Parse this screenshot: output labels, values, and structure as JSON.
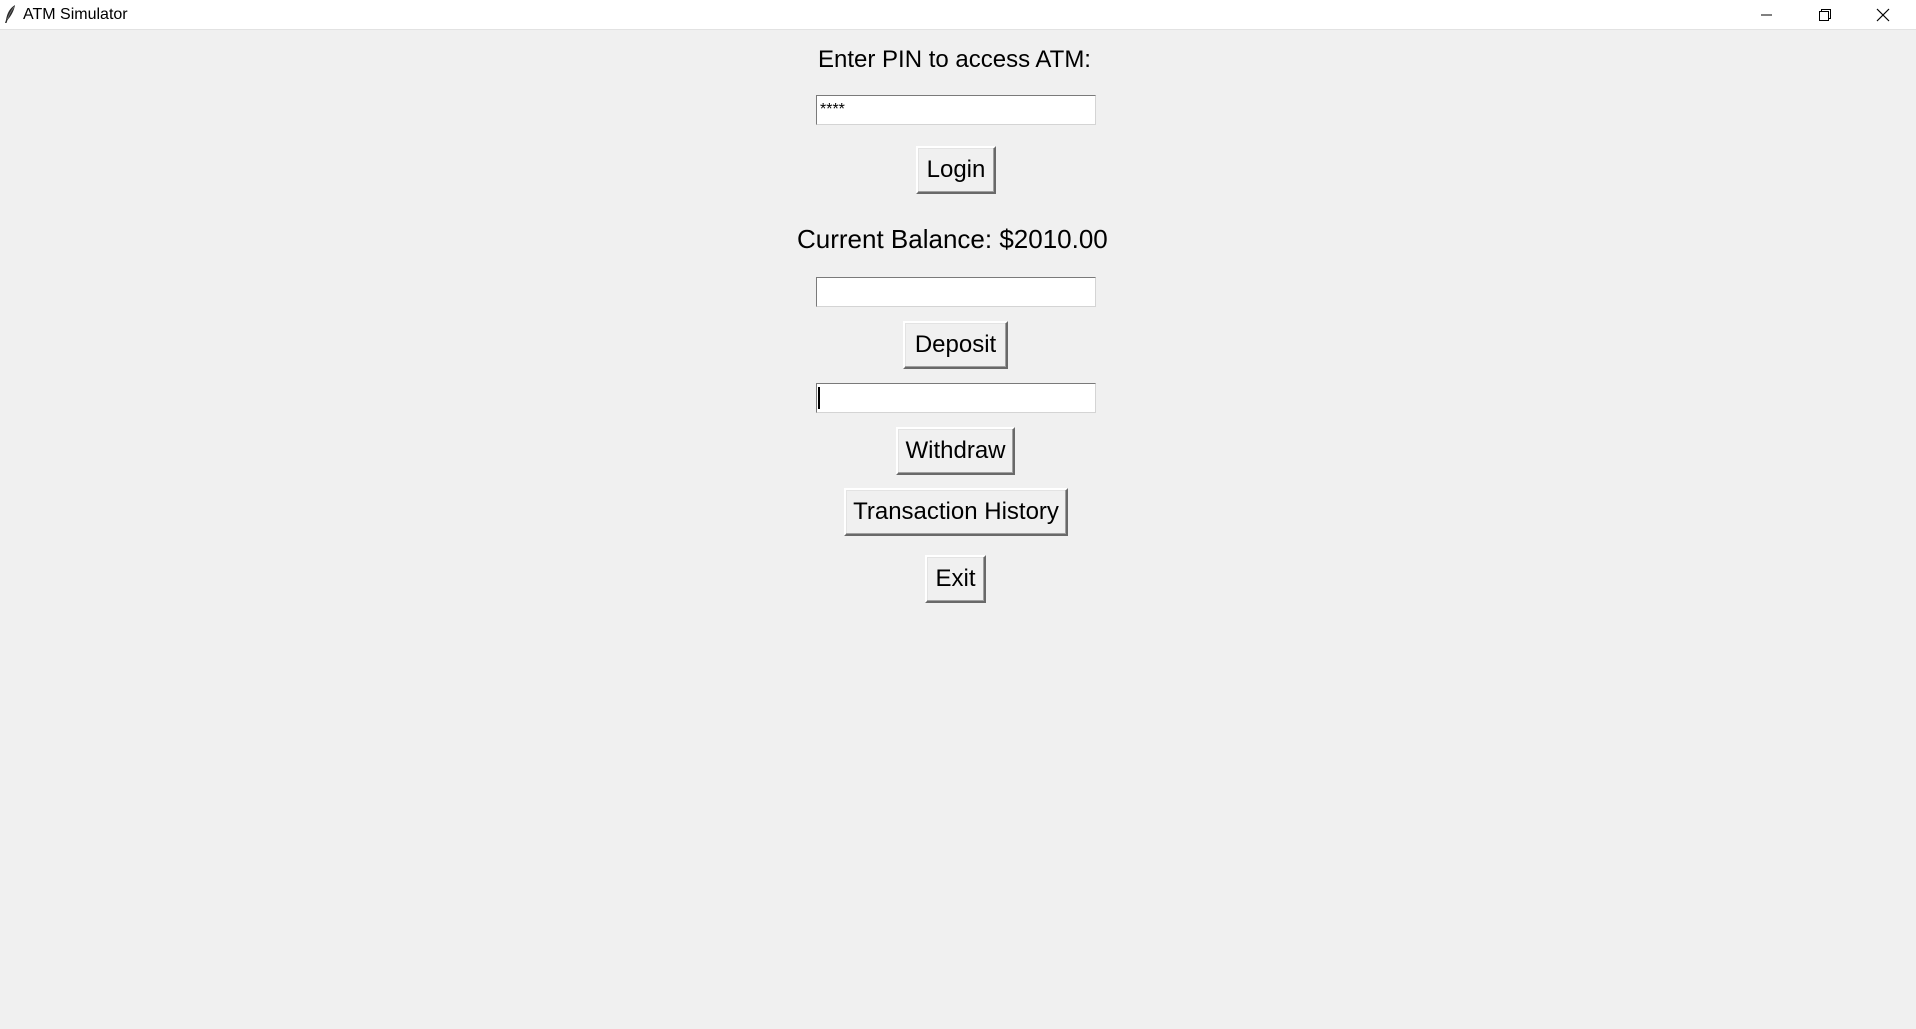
{
  "window": {
    "title": "ATM Simulator",
    "controls": {
      "minimize_icon": "minimize-icon",
      "maximize_icon": "restore-icon",
      "close_icon": "close-icon"
    }
  },
  "login": {
    "prompt": "Enter PIN to access ATM:",
    "pin_value": "****",
    "login_label": "Login"
  },
  "account": {
    "balance_text": "Current Balance: $2010.00"
  },
  "deposit": {
    "amount_value": "",
    "button_label": "Deposit"
  },
  "withdraw": {
    "amount_value": "",
    "button_label": "Withdraw"
  },
  "actions": {
    "history_label": "Transaction History",
    "exit_label": "Exit"
  },
  "colors": {
    "background": "#f0f0f0",
    "titlebar": "#ffffff",
    "text": "#000000"
  }
}
